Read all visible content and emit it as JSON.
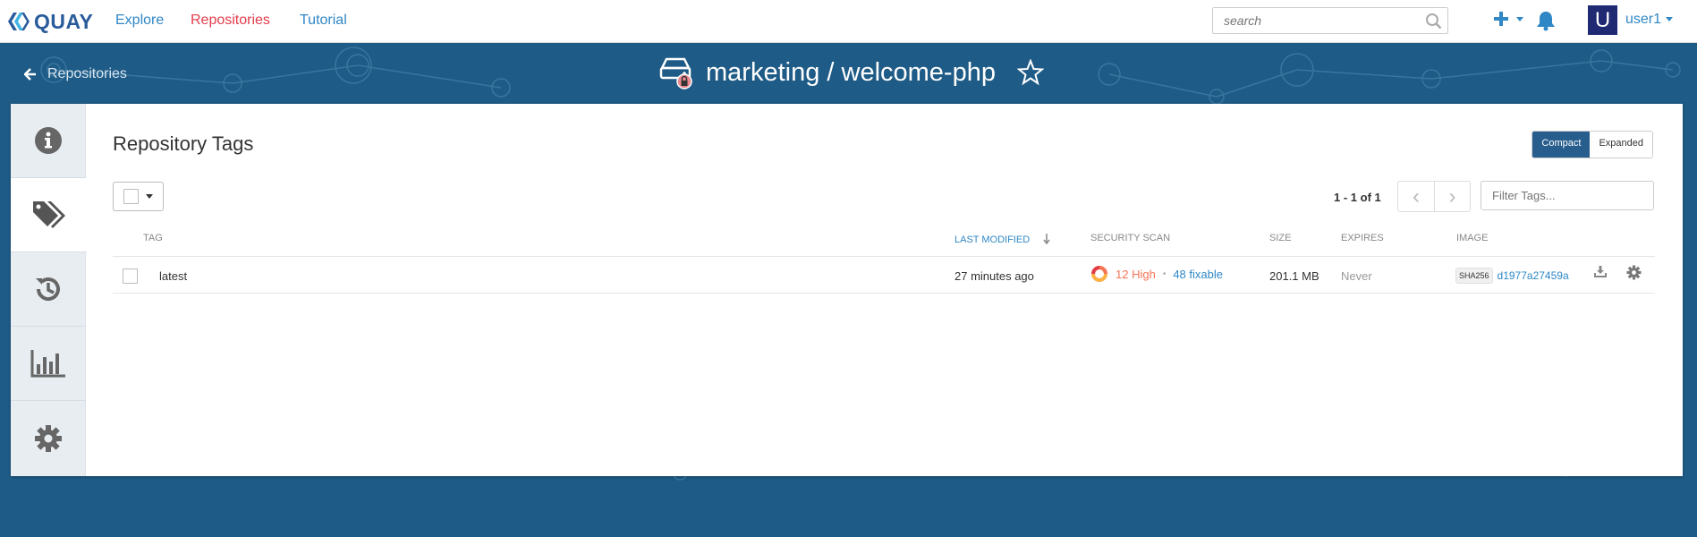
{
  "navbar": {
    "logo_text": "QUAY",
    "links": [
      "Explore",
      "Repositories",
      "Tutorial"
    ],
    "search_placeholder": "search",
    "user": {
      "initial": "U",
      "name": "user1"
    }
  },
  "header": {
    "back_label": "Repositories",
    "repo_title": "marketing / welcome-php"
  },
  "sidebar": {
    "tabs": [
      {
        "name": "info",
        "icon": "info-icon"
      },
      {
        "name": "tags",
        "icon": "tags-icon",
        "active": true
      },
      {
        "name": "history",
        "icon": "history-icon"
      },
      {
        "name": "usage",
        "icon": "bar-chart-icon"
      },
      {
        "name": "settings",
        "icon": "gear-icon"
      }
    ]
  },
  "tags_panel": {
    "title": "Repository Tags",
    "view_modes": {
      "compact": "Compact",
      "expanded": "Expanded",
      "selected": "Compact"
    },
    "paging": "1 - 1 of 1",
    "filter_placeholder": "Filter Tags...",
    "columns": {
      "tag": "Tag",
      "last_modified": "Last Modified",
      "security_scan": "Security Scan",
      "size": "Size",
      "expires": "Expires",
      "image": "Image"
    },
    "rows": [
      {
        "tag": "latest",
        "last_modified": "27 minutes ago",
        "scan_high": "12 High",
        "scan_fixable": "48 fixable",
        "size": "201.1 MB",
        "expires": "Never",
        "sha_label": "SHA256",
        "digest": "d1977a27459a"
      }
    ]
  },
  "colors": {
    "brand_blue": "#2a5b9b",
    "link_blue": "#2f87c6",
    "active_red": "#e23c4b",
    "band": "#1e5b86",
    "high_orange": "#f77454",
    "toggle_active": "#285e8e"
  }
}
